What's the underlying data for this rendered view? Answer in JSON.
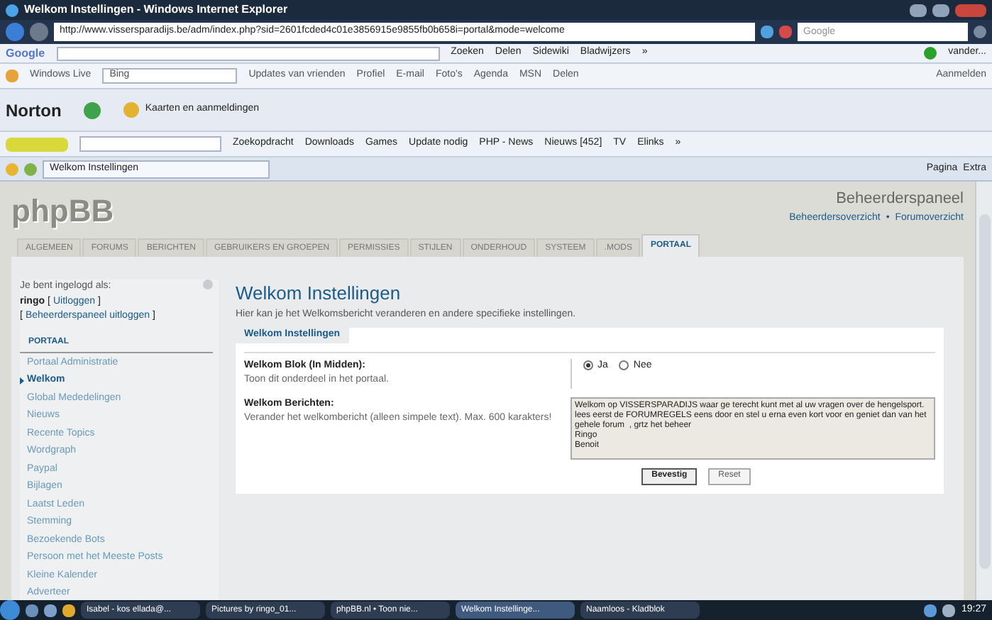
{
  "window": {
    "title": "Welkom Instellingen - Windows Internet Explorer"
  },
  "address_bar": {
    "url": "http://www.vissersparadijs.be/adm/index.php?sid=2601fcded4c01e3856915e9855fb0b658i=portal&mode=welcome"
  },
  "search_box": {
    "placeholder": "Google"
  },
  "google_toolbar": {
    "logo": "Google",
    "items": [
      "Zoeken",
      "Delen",
      "Sidewiki",
      "Bladwijzers",
      "»"
    ],
    "account": "vander..."
  },
  "live_toolbar": {
    "brand": "Windows Live",
    "search_value": "Bing",
    "links": [
      "Updates van vrienden",
      "Profiel",
      "E-mail",
      "Foto's",
      "Agenda",
      "MSN",
      "Delen"
    ],
    "signin": "Aanmelden"
  },
  "norton_toolbar": {
    "brand": "Norton",
    "cards": "Kaarten en aanmeldingen"
  },
  "toolbar": {
    "items": [
      "Zoekopdracht",
      "Downloads",
      "Games",
      "Update nodig",
      "PHP - News",
      "Nieuws [452]",
      "TV",
      "Elinks",
      "»"
    ]
  },
  "tab_bar": {
    "tab": "Welkom Instellingen",
    "commands": [
      "Pagina",
      "Extra"
    ]
  },
  "page": {
    "logo": "phpBB",
    "title": "Beheerderspaneel",
    "links": [
      "Beheerdersoverzicht",
      "Forumoverzicht"
    ],
    "separator": "•",
    "tabs": [
      {
        "label": "ALGEMEEN",
        "selected": false
      },
      {
        "label": "FORUMS",
        "selected": false
      },
      {
        "label": "BERICHTEN",
        "selected": false
      },
      {
        "label": "GEBRUIKERS EN GROEPEN",
        "selected": false
      },
      {
        "label": "PERMISSIES",
        "selected": false
      },
      {
        "label": "STIJLEN",
        "selected": false
      },
      {
        "label": "ONDERHOUD",
        "selected": false
      },
      {
        "label": "SYSTEEM",
        "selected": false
      },
      {
        "label": ".MODS",
        "selected": false
      },
      {
        "label": "PORTAAL",
        "selected": true
      }
    ],
    "sidebar": {
      "login_label": "Je bent ingelogd als:",
      "user": "ringo",
      "bracket_open": "[",
      "bracket_close": "]",
      "logout": "Uitloggen",
      "admin_logout": "Beheerderspaneel uitloggen",
      "section": "PORTAAL",
      "items": [
        {
          "label": "Portaal Administratie",
          "selected": false
        },
        {
          "label": "Welkom",
          "selected": true
        },
        {
          "label": "Global Mededelingen",
          "selected": false
        },
        {
          "label": "Nieuws",
          "selected": false
        },
        {
          "label": "Recente Topics",
          "selected": false
        },
        {
          "label": "Wordgraph",
          "selected": false
        },
        {
          "label": "Paypal",
          "selected": false
        },
        {
          "label": "Bijlagen",
          "selected": false
        },
        {
          "label": "Laatst Leden",
          "selected": false
        },
        {
          "label": "Stemming",
          "selected": false
        },
        {
          "label": "Bezoekende Bots",
          "selected": false
        },
        {
          "label": "Persoon met het Meeste Posts",
          "selected": false
        },
        {
          "label": "Kleine Kalender",
          "selected": false
        },
        {
          "label": "Adverteer",
          "selected": false
        }
      ]
    },
    "main": {
      "title": "Welkom Instellingen",
      "description": "Hier kan je het Welkomsbericht veranderen en andere specifieke instellingen.",
      "legend": "Welkom Instellingen",
      "block": {
        "label": "Welkom Blok (In Midden):",
        "hint": "Toon dit onderdeel in het portaal.",
        "options": [
          {
            "label": "Ja",
            "selected": true
          },
          {
            "label": "Nee",
            "selected": false
          }
        ]
      },
      "message": {
        "label": "Welkom Berichten:",
        "hint": "Verander het welkombericht (alleen simpele text). Max. 600 karakters!",
        "value": "Welkom op VISSERSPARADIJS waar ge terecht kunt met al uw vragen over de hengelsport.\nlees eerst de FORUMREGELS eens door en stel u erna even kort voor en geniet dan van het gehele forum  , grtz het beheer\nRingo\nBenoit"
      },
      "buttons": [
        {
          "label": "Bevestig",
          "kind": "primary"
        },
        {
          "label": "Reset",
          "kind": "secondary"
        }
      ]
    }
  },
  "taskbar": {
    "items": [
      {
        "label": "Isabel - kos ellada@...",
        "selected": false
      },
      {
        "label": "Pictures by ringo_01...",
        "selected": false
      },
      {
        "label": "phpBB.nl • Toon nie...",
        "selected": false
      },
      {
        "label": "Welkom Instellinge...",
        "selected": true
      },
      {
        "label": "Naamloos - Kladblok",
        "selected": false
      }
    ],
    "clock": "19:27"
  }
}
